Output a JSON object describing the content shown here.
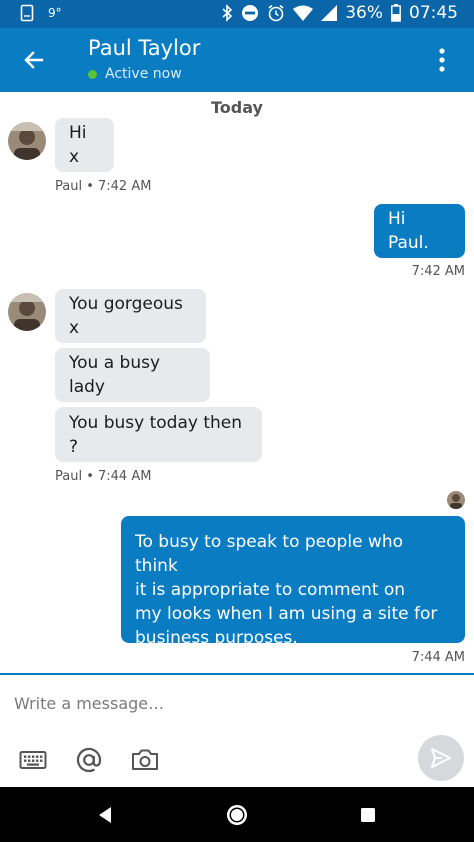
{
  "status_bar": {
    "temperature": "9°",
    "battery": "36%",
    "time": "07:45"
  },
  "header": {
    "contact_name": "Paul Taylor",
    "presence": "Active now",
    "back_icon": "arrow-left-icon",
    "menu_icon": "more-vert-icon"
  },
  "thread": {
    "day_label": "Today",
    "messages": [
      {
        "direction": "incoming",
        "text": "Hi x"
      },
      {
        "direction": "outgoing",
        "text": "Hi Paul."
      },
      {
        "direction": "incoming",
        "text": "You gorgeous x"
      },
      {
        "direction": "incoming",
        "text": "You a busy lady"
      },
      {
        "direction": "incoming",
        "text": "You busy today then ?"
      },
      {
        "direction": "outgoing",
        "lines": [
          "To busy to speak to people who think",
          "it is appropriate to comment on",
          "my looks when I am using a site for",
          "business purposes."
        ]
      }
    ],
    "meta": {
      "m1": "Paul • 7:42 AM",
      "m2": "7:42 AM",
      "m3": "Paul • 7:44 AM",
      "m4": "7:44 AM"
    }
  },
  "composer": {
    "placeholder": "Write a message…",
    "tools": [
      "keyboard-icon",
      "mention-icon",
      "camera-icon"
    ],
    "send_icon": "send-icon"
  },
  "colors": {
    "brand": "#0a7dc2",
    "status_bar": "#0a66a8",
    "incoming_bubble": "#e7e9ec",
    "presence_green": "#5bc236"
  }
}
